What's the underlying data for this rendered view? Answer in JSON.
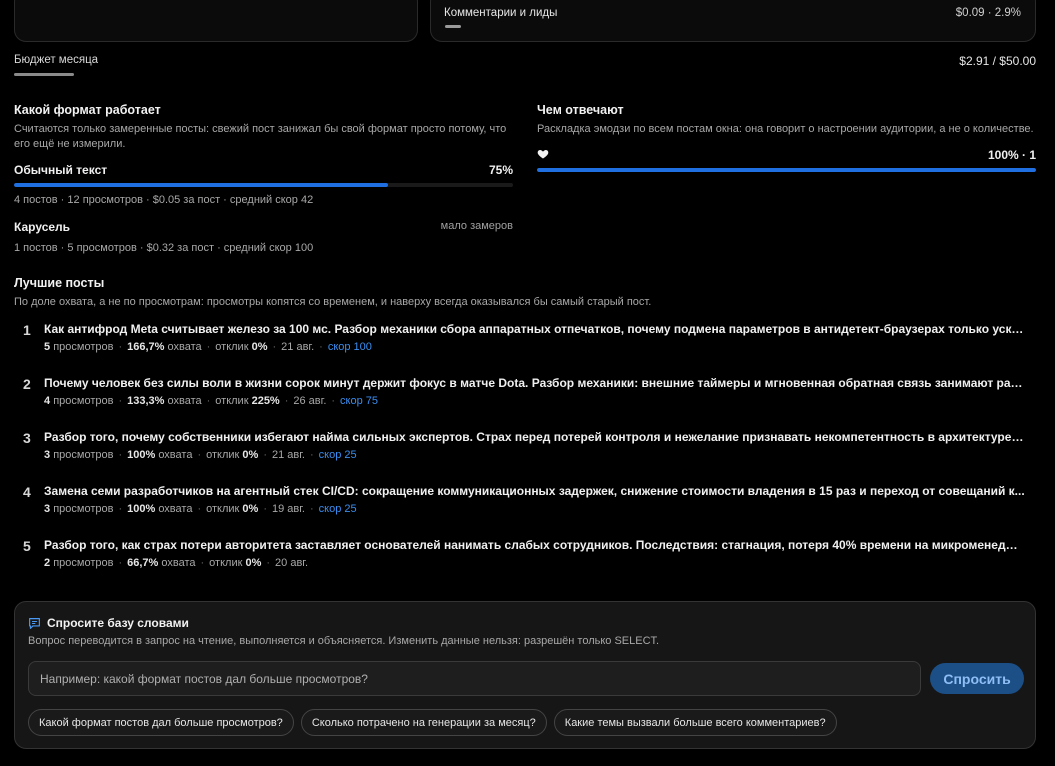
{
  "top_cards": {
    "left": {},
    "right": {
      "label": "Комментарии и лиды",
      "value": "$0.09 · 2.9%",
      "share": 0.029
    }
  },
  "budget": {
    "label": "Бюджет месяца",
    "value": "$2.91 / $50.00",
    "fraction": 0.058
  },
  "formats": {
    "title": "Какой формат работает",
    "description": "Считаются только замеренные посты: свежий пост занижал бы свой формат просто потому, что его ещё не измерили.",
    "items": [
      {
        "name": "Обычный текст",
        "pct_label": "75%",
        "pct": 75,
        "meta": "4 постов · 12 просмотров · $0.05 за пост · средний скор 42"
      },
      {
        "name": "Карусель",
        "note": "мало замеров",
        "meta": "1 постов · 5 просмотров · $0.32 за пост · средний скор 100"
      }
    ]
  },
  "reactions": {
    "title": "Чем отвечают",
    "description": "Раскладка эмодзи по всем постам окна: она говорит о настроении аудитории, а не о количестве.",
    "items": [
      {
        "emoji_icon": "heart-icon",
        "value_label": "100% · 1",
        "pct": 100
      }
    ]
  },
  "best_posts": {
    "title": "Лучшие посты",
    "description": "По доле охвата, а не по просмотрам: просмотры копятся со временем, и наверху всегда оказывался бы самый старый пост.",
    "labels": {
      "views": "просмотров",
      "reach": "охвата",
      "response": "отклик"
    },
    "items": [
      {
        "rank": "1",
        "title": "Как антифрод Meta считывает железо за 100 мс. Разбор механики сбора аппаратных отпечатков, почему подмена параметров в антидетект-браузерах только ускоряе...",
        "views": "5",
        "reach": "166,7%",
        "response": "0%",
        "date": "21 авг.",
        "score": "скор 100"
      },
      {
        "rank": "2",
        "title": "Почему человек без силы воли в жизни сорок минут держит фокус в матче Dota. Разбор механики: внешние таймеры и мгновенная обратная связь занимают рабочую...",
        "views": "4",
        "reach": "133,3%",
        "response": "225%",
        "date": "26 авг.",
        "score": "скор 75"
      },
      {
        "rank": "3",
        "title": "Разбор того, почему собственники избегают найма сильных экспертов. Страх перед потерей контроля и нежелание признавать некомпетентность в архитектуре стоят...",
        "views": "3",
        "reach": "100%",
        "response": "0%",
        "date": "21 авг.",
        "score": "скор 25"
      },
      {
        "rank": "4",
        "title": "Замена семи разработчиков на агентный стек CI/CD: сокращение коммуникационных задержек, снижение стоимости владения в 15 раз и переход от совещаний к...",
        "views": "3",
        "reach": "100%",
        "response": "0%",
        "date": "19 авг.",
        "score": "скор 25"
      },
      {
        "rank": "5",
        "title": "Разбор того, как страх потери авторитета заставляет основателей нанимать слабых сотрудников. Последствия: стагнация, потеря 40% времени на микроменеджмент ...",
        "views": "2",
        "reach": "66,7%",
        "response": "0%",
        "date": "20 авг.",
        "score": ""
      }
    ]
  },
  "ask": {
    "title": "Спросите базу словами",
    "description": "Вопрос переводится в запрос на чтение, выполняется и объясняется. Изменить данные нельзя: разрешён только SELECT.",
    "input_value": "",
    "placeholder": "Например: какой формат постов дал больше просмотров?",
    "button_label": "Спросить",
    "suggestions": [
      "Какой формат постов дал больше просмотров?",
      "Сколько потрачено на генерации за месяц?",
      "Какие темы вызвали больше всего комментариев?"
    ]
  },
  "colors": {
    "accent": "#1f6fe0",
    "link": "#3a8ef0",
    "button_bg": "#1b4f86",
    "button_text": "#8fbef5"
  }
}
